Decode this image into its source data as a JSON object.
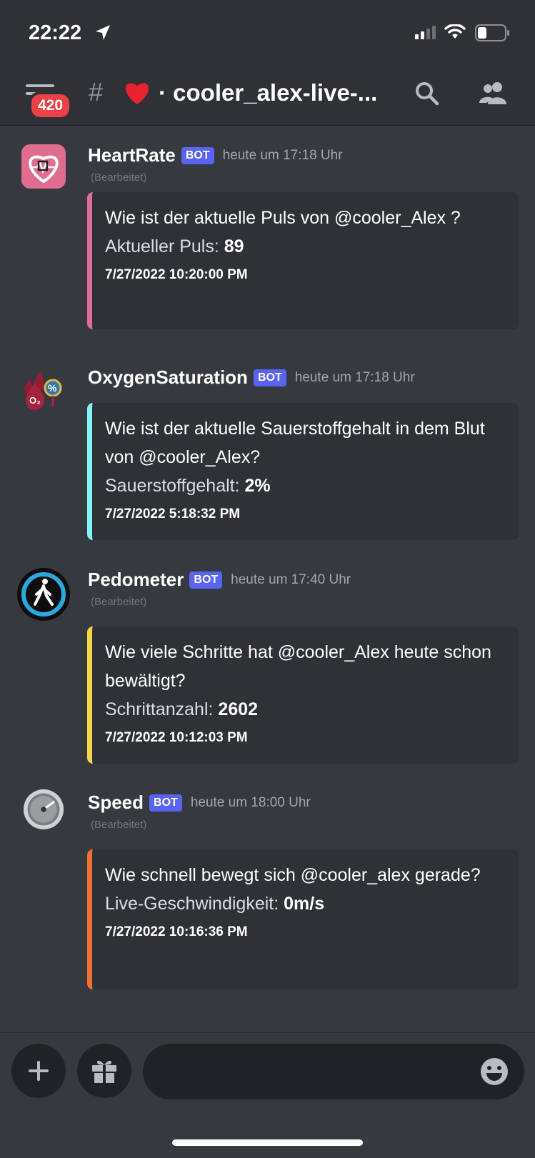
{
  "status": {
    "time": "22:22"
  },
  "header": {
    "badge": "420",
    "channel_prefix": "#",
    "channel_name": "· cooler_alex-live-..."
  },
  "messages": [
    {
      "name": "HeartRate",
      "bot": "BOT",
      "timestamp": "heute um 17:18 Uhr",
      "edited": "(Bearbeitet)",
      "question": "Wie ist der aktuelle Puls von @cooler_Alex ?",
      "label": "Aktueller Puls: ",
      "value": "89",
      "date": "7/27/2022 10:20:00 PM",
      "color": "#e06c9f"
    },
    {
      "name": "OxygenSaturation",
      "bot": "BOT",
      "timestamp": "heute um 17:18 Uhr",
      "edited": "",
      "question": "Wie ist der aktuelle Sauerstoffgehalt in dem Blut von @cooler_Alex?",
      "label": "Sauerstoffgehalt: ",
      "value": "2%",
      "date": "7/27/2022 5:18:32 PM",
      "color": "#7ff7f5"
    },
    {
      "name": "Pedometer",
      "bot": "BOT",
      "timestamp": "heute um 17:40 Uhr",
      "edited": "(Bearbeitet)",
      "question": "Wie viele Schritte hat @cooler_Alex heute schon bewältigt?",
      "label": "Schrittanzahl: ",
      "value": "2602",
      "date": "7/27/2022 10:12:03 PM",
      "color": "#f2d74a"
    },
    {
      "name": "Speed",
      "bot": "BOT",
      "timestamp": "heute um 18:00 Uhr",
      "edited": "(Bearbeitet)",
      "question": "Wie schnell bewegt sich @cooler_alex gerade?",
      "label": "Live-Geschwindigkeit: ",
      "value": "0m/s",
      "date": "7/27/2022 10:16:36 PM",
      "color": "#f07130"
    }
  ],
  "icons": {
    "location": "location-arrow-icon",
    "signal": "cellular-signal-icon",
    "wifi": "wifi-icon",
    "battery": "battery-icon",
    "menu": "hamburger-menu-icon",
    "heart": "red-heart-icon",
    "search": "search-icon",
    "members": "members-icon",
    "plus": "plus-icon",
    "gift": "gift-icon",
    "emoji": "emoji-icon"
  }
}
